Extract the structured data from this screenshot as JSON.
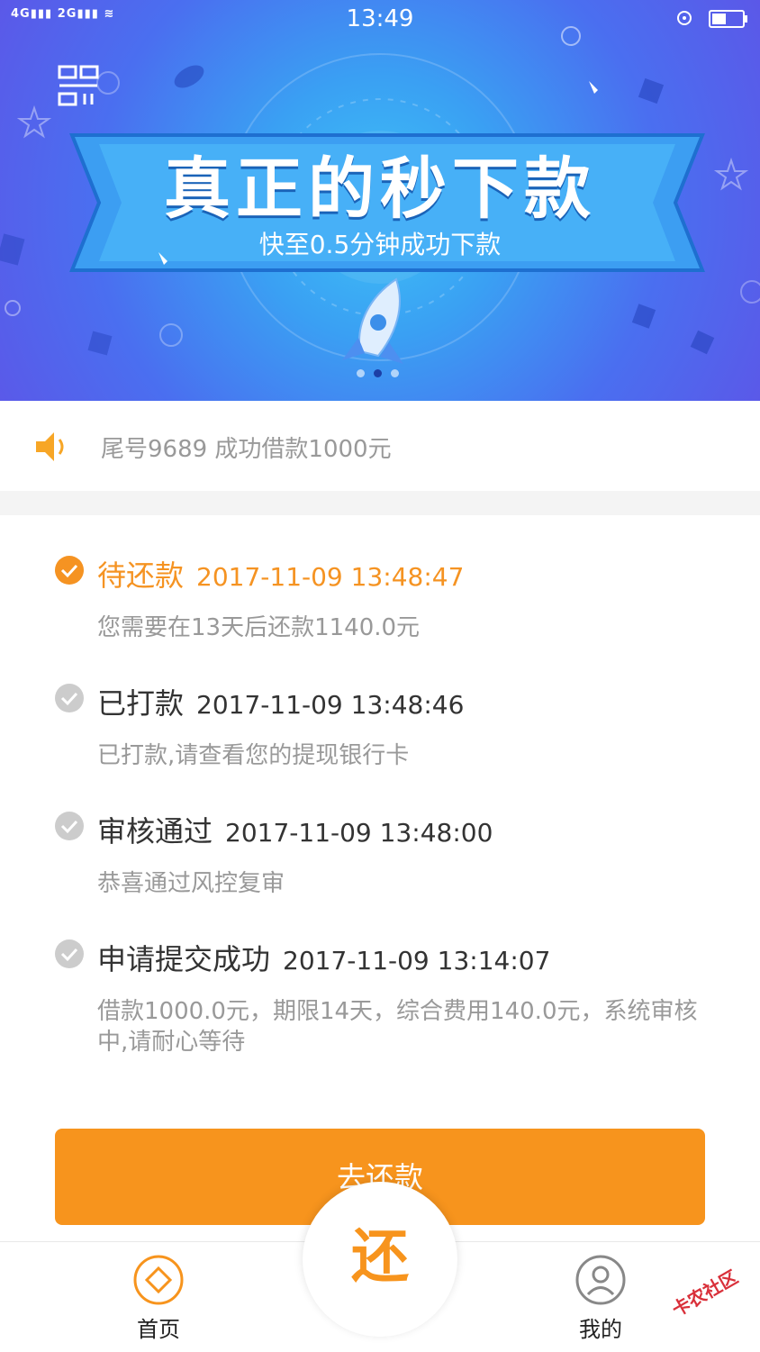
{
  "status_bar": {
    "network_left": "4G",
    "network_right": "2G",
    "time": "13:49"
  },
  "banner": {
    "title": "真正的秒下款",
    "subtitle": "快至0.5分钟成功下款"
  },
  "notice": {
    "text": "尾号9689 成功借款1000元"
  },
  "steps": [
    {
      "title": "待还款",
      "time": "2017-11-09 13:48:47",
      "desc": "您需要在13天后还款1140.0元"
    },
    {
      "title": "已打款",
      "time": "2017-11-09 13:48:46",
      "desc": "已打款,请查看您的提现银行卡"
    },
    {
      "title": "审核通过",
      "time": "2017-11-09 13:48:00",
      "desc": "恭喜通过风控复审"
    },
    {
      "title": "申请提交成功",
      "time": "2017-11-09 13:14:07",
      "desc": "借款1000.0元，期限14天，综合费用140.0元，系统审核中,请耐心等待"
    }
  ],
  "repay_button": "去还款",
  "tabbar": {
    "home": "首页",
    "center": "还",
    "mine": "我的"
  },
  "watermark": "卡农社区",
  "colors": {
    "accent": "#f7941d",
    "active_step": "#f59322",
    "inactive_step": "#cccccc"
  }
}
